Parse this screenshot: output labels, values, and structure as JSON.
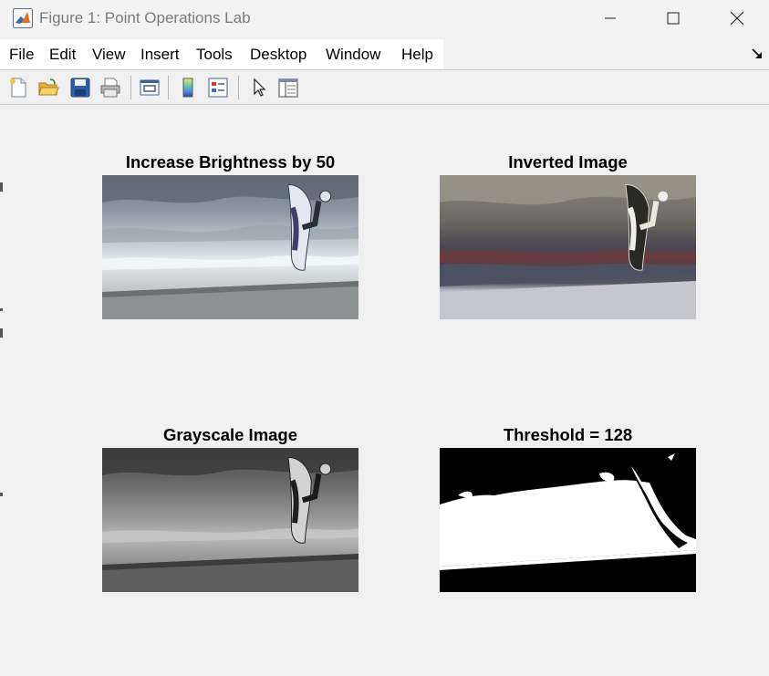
{
  "window": {
    "title": "Figure 1: Point Operations Lab",
    "controls": {
      "minimize": "minimize",
      "maximize": "maximize",
      "close": "close"
    }
  },
  "menubar": {
    "items": [
      "File",
      "Edit",
      "View",
      "Insert",
      "Tools",
      "Desktop",
      "Window",
      "Help"
    ]
  },
  "toolbar": {
    "buttons": [
      "new-figure-icon",
      "open-file-icon",
      "save-icon",
      "print-icon",
      "link-plot-icon",
      "colorbar-icon",
      "legend-icon",
      "select-arrow-icon",
      "property-inspector-icon"
    ]
  },
  "figure": {
    "panels": [
      {
        "title": "Increase Brightness by 50",
        "kind": "brightened"
      },
      {
        "title": "Inverted Image",
        "kind": "inverted"
      },
      {
        "title": "Grayscale Image",
        "kind": "grayscale"
      },
      {
        "title": "Threshold = 128",
        "kind": "threshold"
      }
    ]
  },
  "colors": {
    "matlab_orange": "#e76a1f",
    "matlab_blue": "#2b6fb6",
    "window_bg": "#f0f0f0"
  }
}
